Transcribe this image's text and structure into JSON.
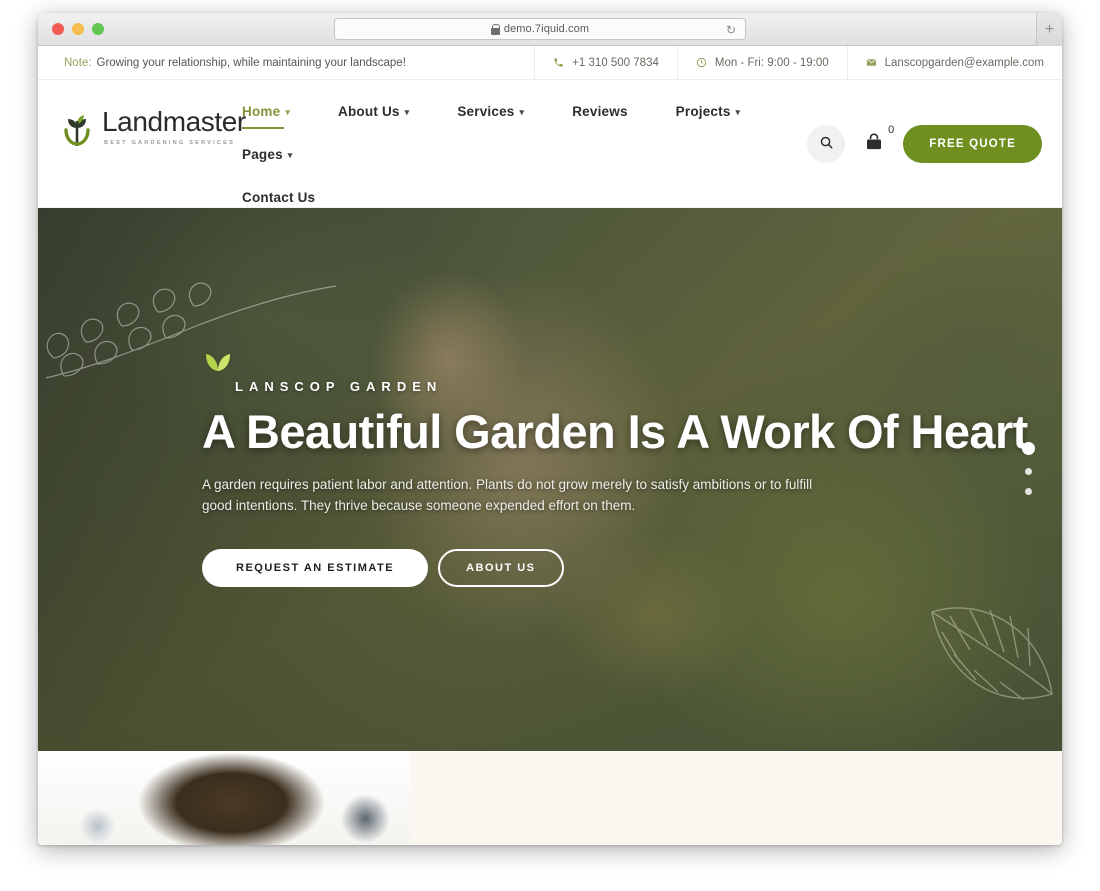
{
  "browser": {
    "url": "demo.7iquid.com",
    "lock_icon": "lock-icon",
    "reload_icon": "reload-icon",
    "new_tab_label": "+",
    "traffic_lights": [
      "close",
      "minimize",
      "maximize"
    ]
  },
  "topbar": {
    "note_label": "Note:",
    "note_text": "Growing your relationship, while maintaining your landscape!",
    "phone": "+1 310 500 7834",
    "hours": "Mon - Fri: 9:00 - 19:00",
    "email": "Lanscopgarden@example.com",
    "phone_icon": "phone-icon",
    "clock_icon": "clock-icon",
    "mail_icon": "mail-icon"
  },
  "header": {
    "logo_name": "Landmaster",
    "logo_tagline": "BEST GARDENING SERVICES",
    "logo_icon": "sprout-logo-icon",
    "nav": [
      {
        "label": "Home",
        "caret": "⌄",
        "active": true
      },
      {
        "label": "About Us",
        "caret": "⌄",
        "active": false
      },
      {
        "label": "Services",
        "caret": "⌄",
        "active": false
      },
      {
        "label": "Reviews",
        "caret": "",
        "active": false
      },
      {
        "label": "Projects",
        "caret": "⌄",
        "active": false
      },
      {
        "label": "Pages",
        "caret": "⌄",
        "active": false
      },
      {
        "label": "Contact Us",
        "caret": "",
        "active": false
      }
    ],
    "search_icon": "search-icon",
    "cart_icon": "shopping-bag-icon",
    "cart_count": "0",
    "quote_button": "FREE QUOTE"
  },
  "hero": {
    "eyebrow": "LANSCOP GARDEN",
    "sprout_icon": "sprout-icon",
    "title": "A Beautiful Garden Is A Work Of Heart",
    "description": "A garden requires patient labor and attention. Plants do not grow merely to satisfy ambitions or to fulfill good intentions. They thrive because someone expended effort on them.",
    "primary_button": "REQUEST AN ESTIMATE",
    "secondary_button": "ABOUT US",
    "slides": [
      {
        "index": "1",
        "active": true
      },
      {
        "index": "2",
        "active": false
      },
      {
        "index": "3",
        "active": false
      }
    ],
    "vine_ornament": "vine-ornament-icon",
    "leaf_ornament": "leaf-ornament-icon"
  },
  "colors": {
    "brand_green": "#6f9021",
    "accent_olive": "#7f9437",
    "leaf_light": "#b5d44a",
    "panel_cream": "#faf6f0",
    "text_dark": "#2d2d2d"
  }
}
